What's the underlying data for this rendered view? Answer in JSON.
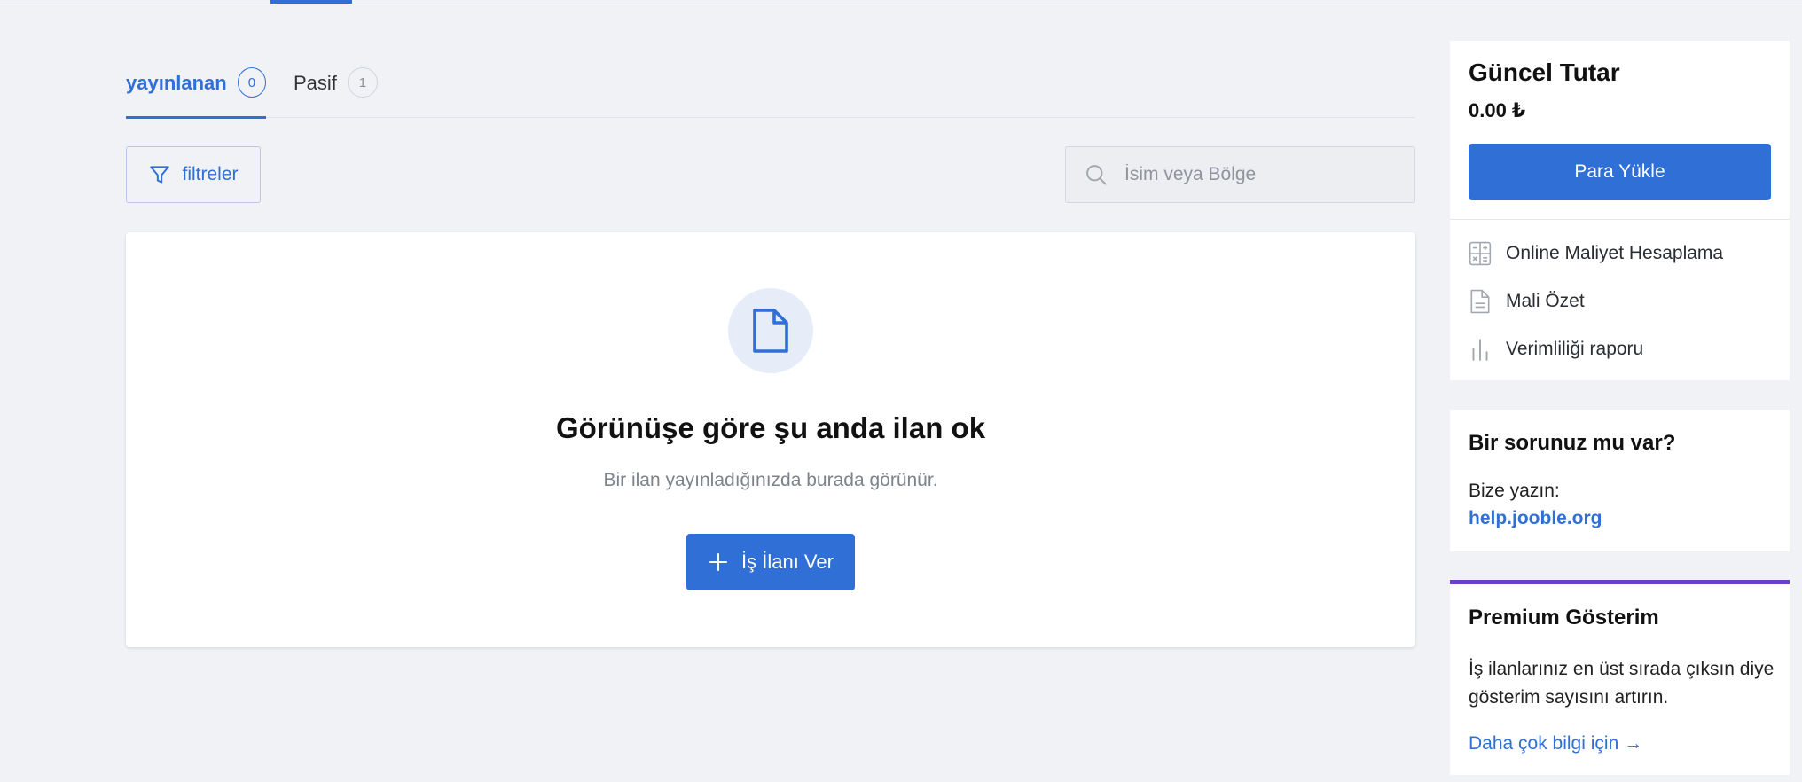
{
  "tabs": [
    {
      "label": "yayınlanan",
      "count": "0"
    },
    {
      "label": "Pasif",
      "count": "1"
    }
  ],
  "filters": {
    "label": "filtreler"
  },
  "search": {
    "placeholder": "İsim veya Bölge"
  },
  "empty_state": {
    "title": "Görünüşe göre şu anda ilan ok",
    "subtitle": "Bir ilan yayınladığınızda burada görünür.",
    "button_label": "İş İlanı Ver"
  },
  "balance": {
    "title": "Güncel Tutar",
    "amount": "0.00 ₺",
    "topup_label": "Para Yükle",
    "links": [
      {
        "label": "Online Maliyet Hesaplama",
        "icon": "calculator-icon"
      },
      {
        "label": "Mali Özet",
        "icon": "document-icon"
      },
      {
        "label": "Verimliliği raporu",
        "icon": "bar-chart-icon"
      }
    ]
  },
  "help": {
    "title": "Bir sorunuz mu var?",
    "write_label": "Bize yazın:",
    "link": "help.jooble.org"
  },
  "premium": {
    "title": "Premium Gösterim",
    "text": "İş ilanlarınız en üst sırada çıksın diye gösterim sayısını artırın.",
    "link": "Daha çok bilgi için →"
  },
  "colors": {
    "accent": "#2f6fd6",
    "premium_border": "#6b3fc6",
    "background": "#f0f2f6"
  }
}
